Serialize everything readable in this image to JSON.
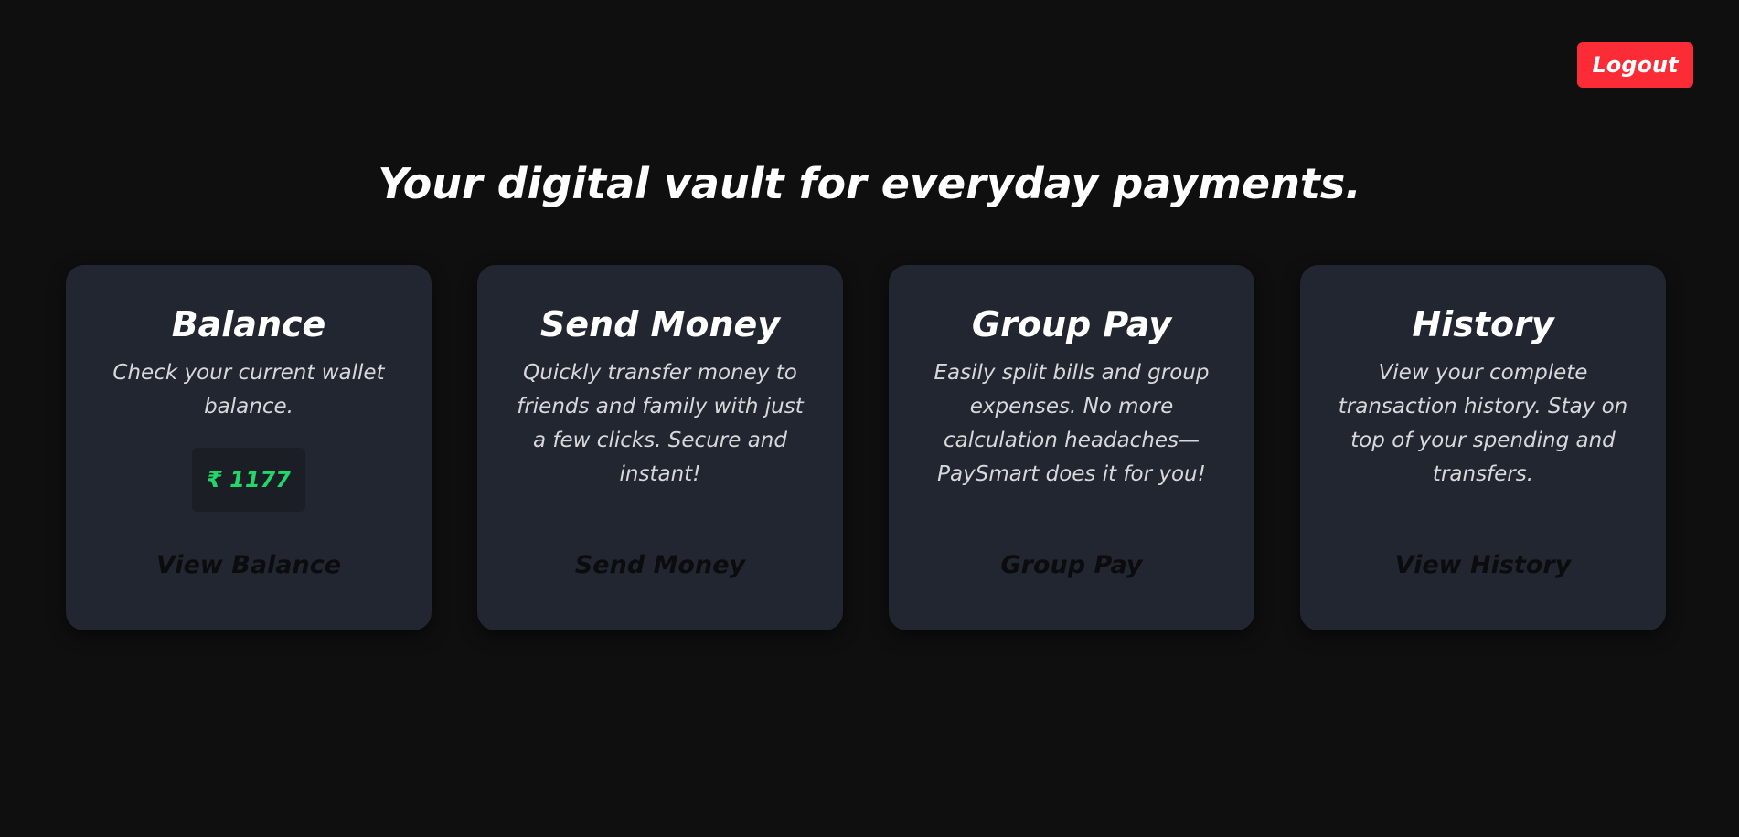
{
  "header": {
    "logout_label": "Logout"
  },
  "hero": {
    "headline": "Your digital vault for everyday payments."
  },
  "cards": [
    {
      "title": "Balance",
      "description": "Check your current wallet balance.",
      "balance_value": "₹ 1177",
      "action_label": "View Balance"
    },
    {
      "title": "Send Money",
      "description": "Quickly transfer money to friends and family with just a few clicks. Secure and instant!",
      "action_label": "Send Money"
    },
    {
      "title": "Group Pay",
      "description": "Easily split bills and group expenses. No more calculation headaches—PaySmart does it for you!",
      "action_label": "Group Pay"
    },
    {
      "title": "History",
      "description": "View your complete transaction history. Stay on top of your spending and transfers.",
      "action_label": "View History"
    }
  ],
  "colors": {
    "background": "#0f0f0f",
    "card": "#222630",
    "logout": "#fb2c36",
    "balance_text": "#22d66b"
  }
}
